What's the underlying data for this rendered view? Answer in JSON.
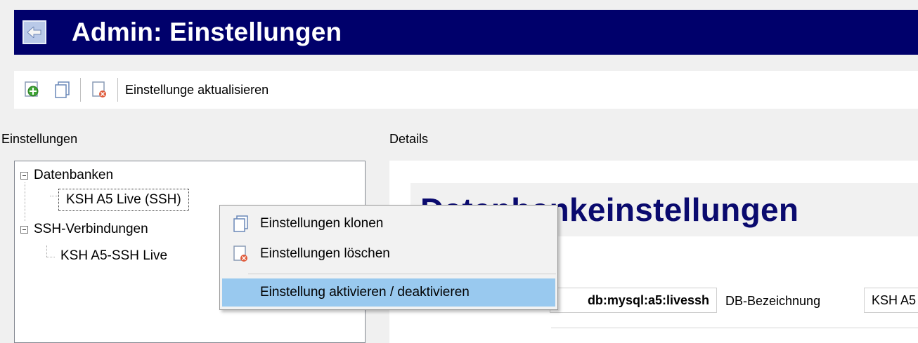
{
  "window": {
    "title": "Admin: Einstellungen"
  },
  "toolbar": {
    "refresh_label": "Einstellunge aktualisieren"
  },
  "left_panel": {
    "label": "Einstellungen",
    "tree": {
      "groups": [
        {
          "label": "Datenbanken",
          "children": [
            "KSH A5 Live (SSH)"
          ]
        },
        {
          "label": "SSH-Verbindungen",
          "children": [
            "KSH A5-SSH Live"
          ]
        }
      ]
    }
  },
  "right_panel": {
    "label": "Details",
    "heading": "Datenbankeinstellungen",
    "field_value": "db:mysql:a5:livessh",
    "db_label": "DB-Bezeichnung",
    "db_value": "KSH A5"
  },
  "context_menu": {
    "items": [
      {
        "label": "Einstellungen klonen",
        "icon": "clone-icon"
      },
      {
        "label": "Einstellungen löschen",
        "icon": "delete-icon"
      },
      {
        "label": "Einstellung aktivieren / deaktivieren",
        "icon": ""
      }
    ]
  }
}
